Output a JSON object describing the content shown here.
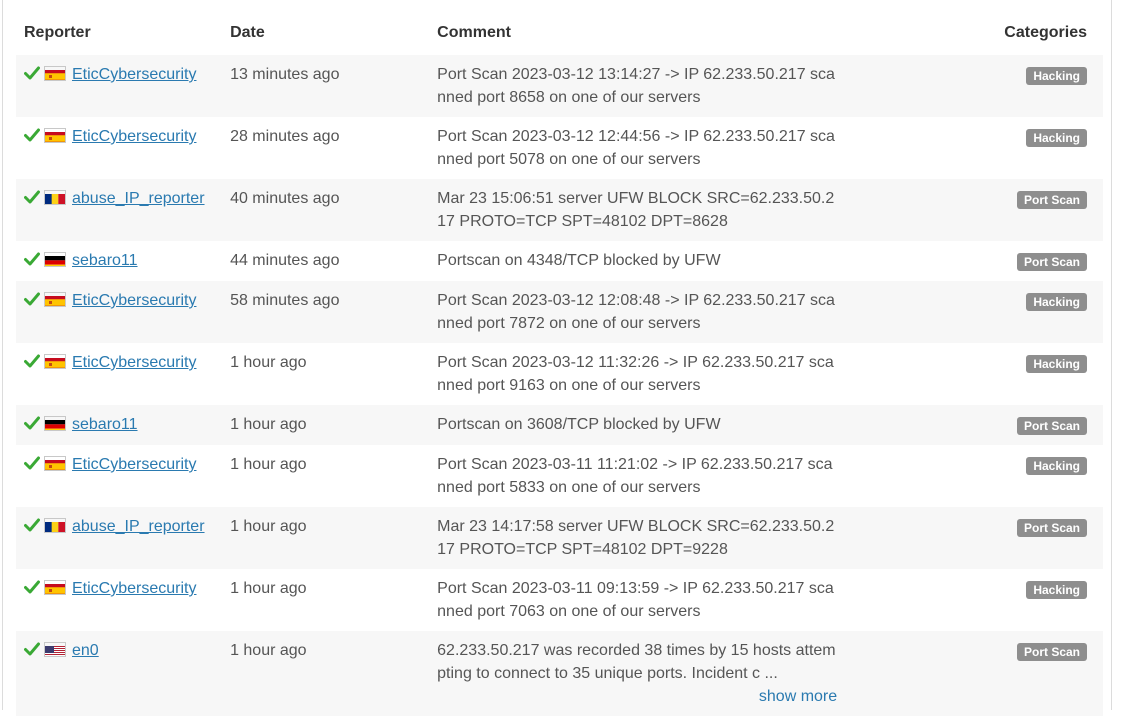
{
  "table": {
    "headers": {
      "reporter": "Reporter",
      "date": "Date",
      "comment": "Comment",
      "categories": "Categories"
    },
    "show_more_label": "show more",
    "rows": [
      {
        "flag": "es",
        "reporter": "EticCybersecurity",
        "date": "13 minutes ago",
        "comment": "Port Scan 2023-03-12 13:14:27 -> IP 62.233.50.217 scanned port 8658 on one of our servers",
        "category": "Hacking"
      },
      {
        "flag": "es",
        "reporter": "EticCybersecurity",
        "date": "28 minutes ago",
        "comment": "Port Scan 2023-03-12 12:44:56 -> IP 62.233.50.217 scanned port 5078 on one of our servers",
        "category": "Hacking"
      },
      {
        "flag": "ro",
        "reporter": "abuse_IP_reporter",
        "date": "40 minutes ago",
        "comment": "Mar 23 15:06:51 server UFW BLOCK SRC=62.233.50.217 PROTO=TCP SPT=48102 DPT=8628",
        "category": "Port Scan"
      },
      {
        "flag": "de",
        "reporter": "sebaro11",
        "date": "44 minutes ago",
        "comment": "Portscan on 4348/TCP blocked by UFW",
        "category": "Port Scan"
      },
      {
        "flag": "es",
        "reporter": "EticCybersecurity",
        "date": "58 minutes ago",
        "comment": "Port Scan 2023-03-12 12:08:48 -> IP 62.233.50.217 scanned port 7872 on one of our servers",
        "category": "Hacking"
      },
      {
        "flag": "es",
        "reporter": "EticCybersecurity",
        "date": "1 hour ago",
        "comment": "Port Scan 2023-03-12 11:32:26 -> IP 62.233.50.217 scanned port 9163 on one of our servers",
        "category": "Hacking"
      },
      {
        "flag": "de",
        "reporter": "sebaro11",
        "date": "1 hour ago",
        "comment": "Portscan on 3608/TCP blocked by UFW",
        "category": "Port Scan"
      },
      {
        "flag": "es",
        "reporter": "EticCybersecurity",
        "date": "1 hour ago",
        "comment": "Port Scan 2023-03-11 11:21:02 -> IP 62.233.50.217 scanned port 5833 on one of our servers",
        "category": "Hacking"
      },
      {
        "flag": "ro",
        "reporter": "abuse_IP_reporter",
        "date": "1 hour ago",
        "comment": "Mar 23 14:17:58 server UFW BLOCK SRC=62.233.50.217 PROTO=TCP SPT=48102 DPT=9228",
        "category": "Port Scan"
      },
      {
        "flag": "es",
        "reporter": "EticCybersecurity",
        "date": "1 hour ago",
        "comment": "Port Scan 2023-03-11 09:13:59 -> IP 62.233.50.217 scanned port 7063 on one of our servers",
        "category": "Hacking"
      },
      {
        "flag": "us",
        "reporter": "en0",
        "date": "1 hour ago",
        "comment": "62.233.50.217 was recorded 38 times by 15 hosts attempting to connect to 35 unique ports. Incident c ...",
        "category": "Port Scan",
        "show_more": true
      }
    ]
  },
  "colors": {
    "link": "#2a7ab0",
    "check": "#3aa935",
    "badge": "#8e8e8e",
    "row_alt": "#f7f7f7"
  }
}
